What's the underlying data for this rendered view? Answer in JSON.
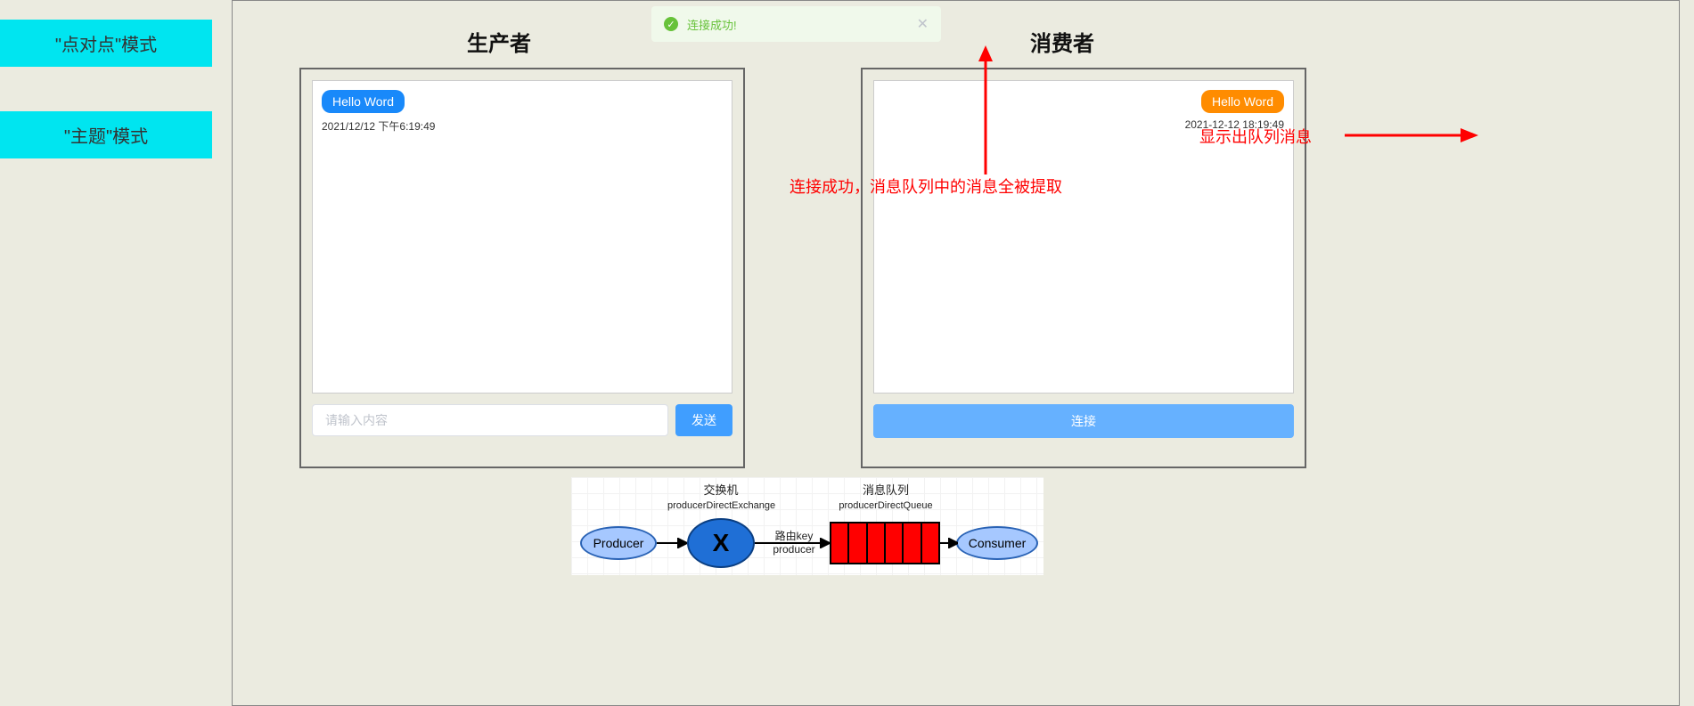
{
  "sidebar": {
    "mode_p2p": "\"点对点\"模式",
    "mode_topic": "\"主题\"模式"
  },
  "titles": {
    "producer": "生产者",
    "consumer": "消费者"
  },
  "toast": {
    "text": "连接成功!"
  },
  "producer": {
    "message": "Hello Word",
    "timestamp": "2021/12/12 下午6:19:49",
    "input_placeholder": "请输入内容",
    "send_btn": "发送"
  },
  "consumer": {
    "message": "Hello Word",
    "timestamp": "2021-12-12 18:19:49",
    "connect_btn": "连接"
  },
  "annotations": {
    "conn_msg": "连接成功，消息队列中的消息全被提取",
    "show_queue": "显示出队列消息"
  },
  "diagram": {
    "exchange_label_top": "交换机",
    "exchange_name": "producerDirectExchange",
    "queue_label_top": "消息队列",
    "queue_name": "producerDirectQueue",
    "producer": "Producer",
    "consumer": "Consumer",
    "exchange_x": "X",
    "route_key_top": "路由key",
    "route_key_bottom": "producer"
  }
}
